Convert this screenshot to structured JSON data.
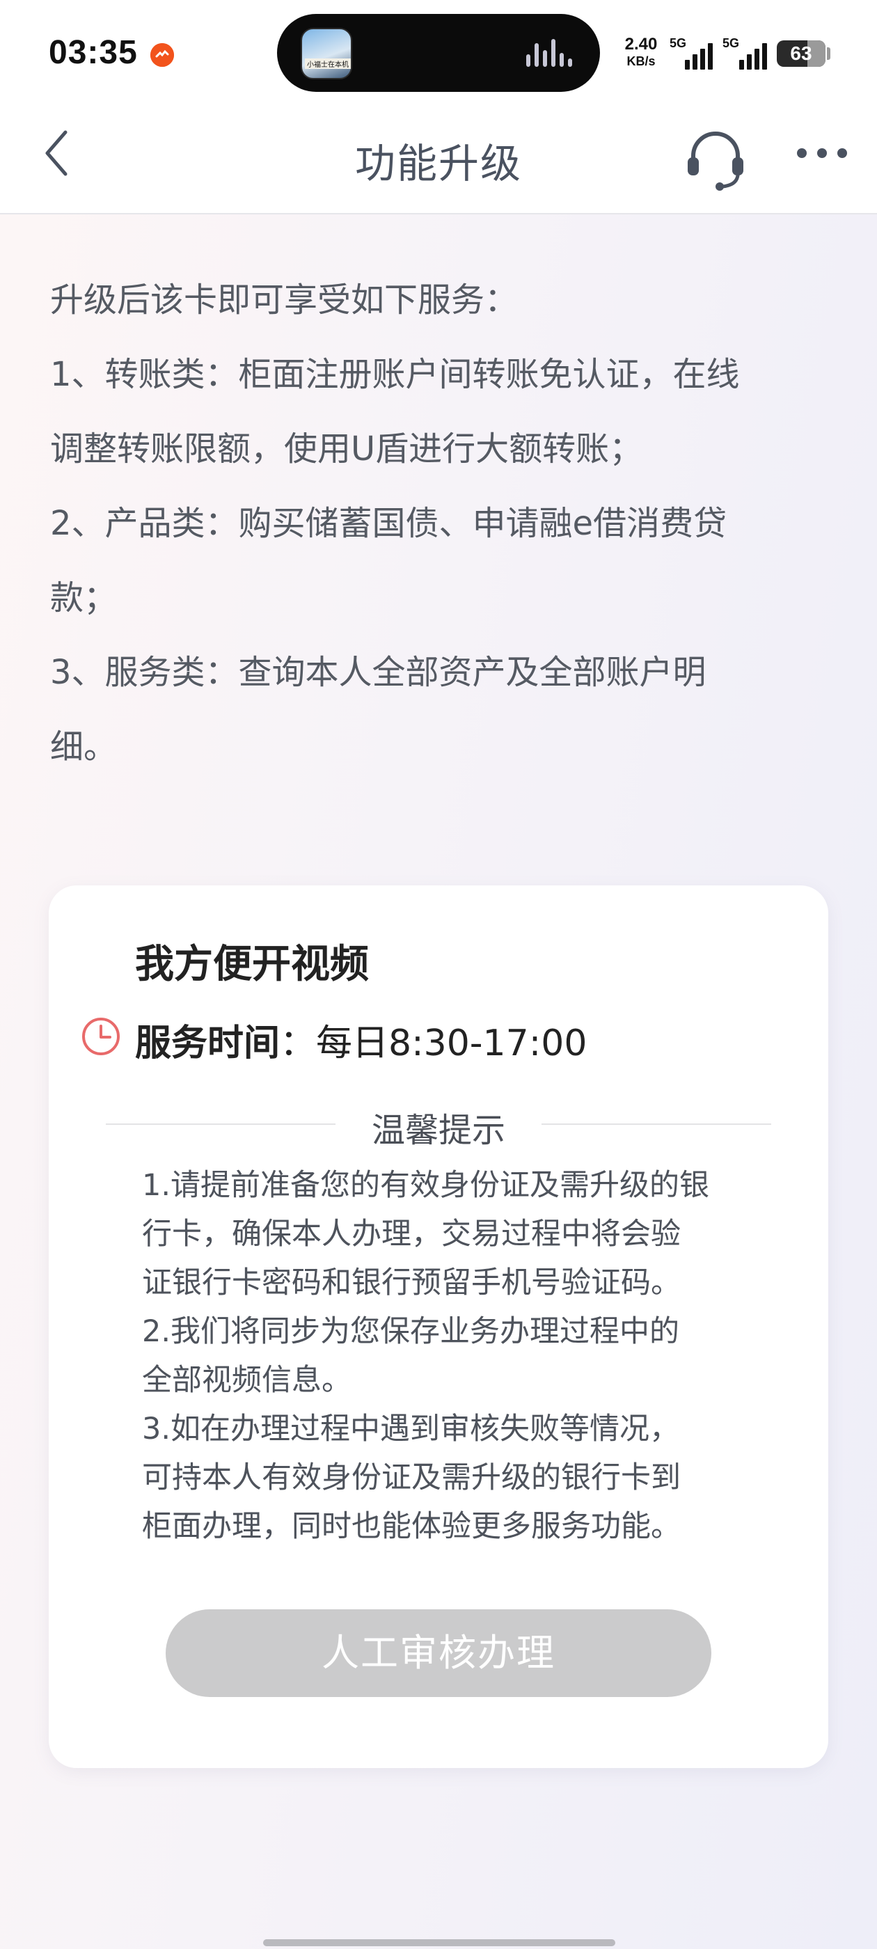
{
  "status_bar": {
    "time": "03:35",
    "island_caption": "小福士在本机",
    "net_speed_value": "2.40",
    "net_speed_unit": "KB/s",
    "sim1_label": "5G",
    "sim2_label": "5G",
    "battery": "63",
    "battery_level": 0.63
  },
  "nav": {
    "title": "功能升级",
    "back_icon": "chevron-left-icon",
    "service_icon": "headset-icon",
    "more_icon": "more-dots-icon"
  },
  "intro": {
    "lines": [
      "升级后该卡即可享受如下服务：",
      "1、转账类：柜面注册账户间转账免认证，在线",
      "调整转账限额，使用U盾进行大额转账；",
      "2、产品类：购买储蓄国债、申请融e借消费贷",
      "款；",
      "3、服务类：查询本人全部资产及全部账户明",
      "细。"
    ]
  },
  "card": {
    "title": "我方便开视频",
    "service_time_label": "服务时间",
    "service_time_value": "：每日8:30-17:00",
    "tips_title": "温馨提示",
    "tips_lines": [
      "1.请提前准备您的有效身份证及需升级的银",
      "行卡，确保本人办理，交易过程中将会验",
      "证银行卡密码和银行预留手机号验证码。",
      "2.我们将同步为您保存业务办理过程中的",
      "全部视频信息。",
      "3.如在办理过程中遇到审核失败等情况，",
      "可持本人有效身份证及需升级的银行卡到",
      "柜面办理，同时也能体验更多服务功能。"
    ],
    "action_button": "人工审核办理"
  },
  "colors": {
    "accent_clock": "#e86a6a",
    "button_disabled": "#cbcbcc",
    "title_text": "#4a5260"
  }
}
